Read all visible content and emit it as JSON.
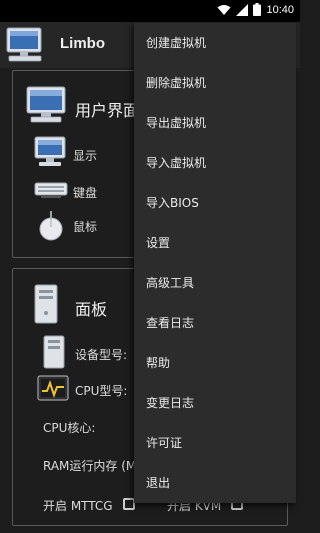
{
  "status_bar": {
    "time": "10:40"
  },
  "app_bar": {
    "title": "Limbo"
  },
  "ui_section": {
    "title": "用户界面",
    "items": [
      {
        "label": "显示",
        "icon": "monitor-icon"
      },
      {
        "label": "键盘",
        "icon": "keyboard-icon"
      },
      {
        "label": "鼠标",
        "icon": "mouse-icon"
      }
    ]
  },
  "board_section": {
    "title": "面板",
    "device_model_label": "设备型号:",
    "cpu_model_label": "CPU型号:",
    "cpu_cores_label": "CPU核心:",
    "ram_label": "RAM运行内存 (M",
    "mttcg_label": "开启 MTTCG",
    "kvm_label": "开启 KVM"
  },
  "menu": {
    "items": [
      "创建虚拟机",
      "删除虚拟机",
      "导出虚拟机",
      "导入虚拟机",
      "导入BIOS",
      "设置",
      "高级工具",
      "查看日志",
      "帮助",
      "变更日志",
      "许可证",
      "退出"
    ]
  },
  "colors": {
    "background": "#1d1d1d",
    "app_bar": "#262626",
    "menu": "#2c2c2c",
    "text": "#ececec"
  }
}
